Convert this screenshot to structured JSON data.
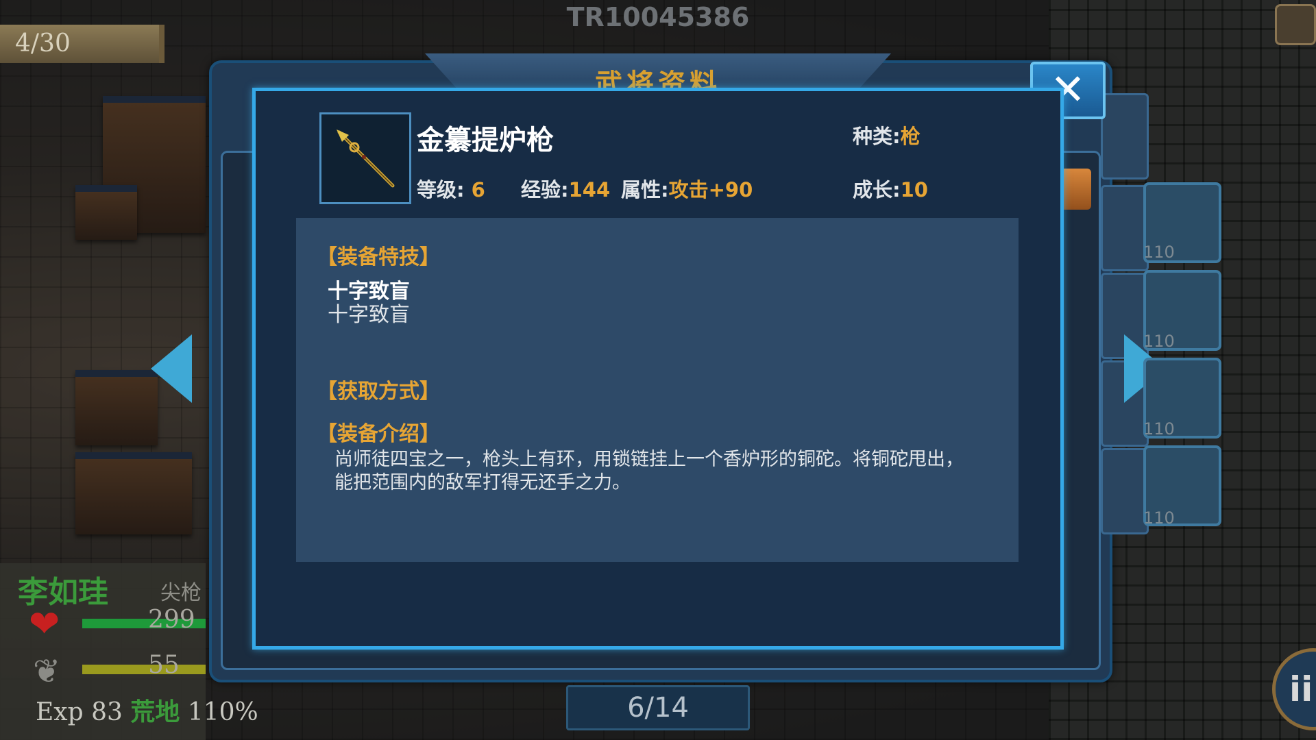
{
  "hud": {
    "turn_counter": "4/30",
    "game_id": "TR10045386",
    "page_counter": "6/14",
    "pause_label": "ii"
  },
  "dialog": {
    "title": "武将资料",
    "close_label": "✕"
  },
  "item": {
    "name": "金纂提炉枪",
    "icon": "spear-icon",
    "type_label": "种类:",
    "type_value": "枪",
    "level_label": "等级:",
    "level_value": "6",
    "exp_label": "经验:",
    "exp_value": "144",
    "attr_label": "属性:",
    "attr_value": "攻击+90",
    "growth_label": "成长:",
    "growth_value": "10"
  },
  "sections": {
    "skill_header": "【装备特技】",
    "skill_name": "十字致盲",
    "skill_desc": "十字致盲",
    "obtain_header": "【获取方式】",
    "intro_header": "【装备介绍】",
    "intro_text": "尚师徒四宝之一，枪头上有环，用锁链挂上一个香炉形的铜砣。将铜砣甩出，能把范围内的敌军打得无还手之力。"
  },
  "equipment_slots": {
    "levels": [
      "110",
      "110",
      "110",
      "110"
    ]
  },
  "character": {
    "name": "李如珪",
    "weapon": "尖枪",
    "hp": "299",
    "sp": "55",
    "exp_label": "Exp",
    "exp_value": "83",
    "terrain": "荒地",
    "terrain_rate": "110%"
  },
  "colors": {
    "accent_gold": "#e7a534",
    "dialog_border": "#35a9e8",
    "char_name": "#3b9b3b",
    "hp_bar": "#1e9a3a"
  }
}
